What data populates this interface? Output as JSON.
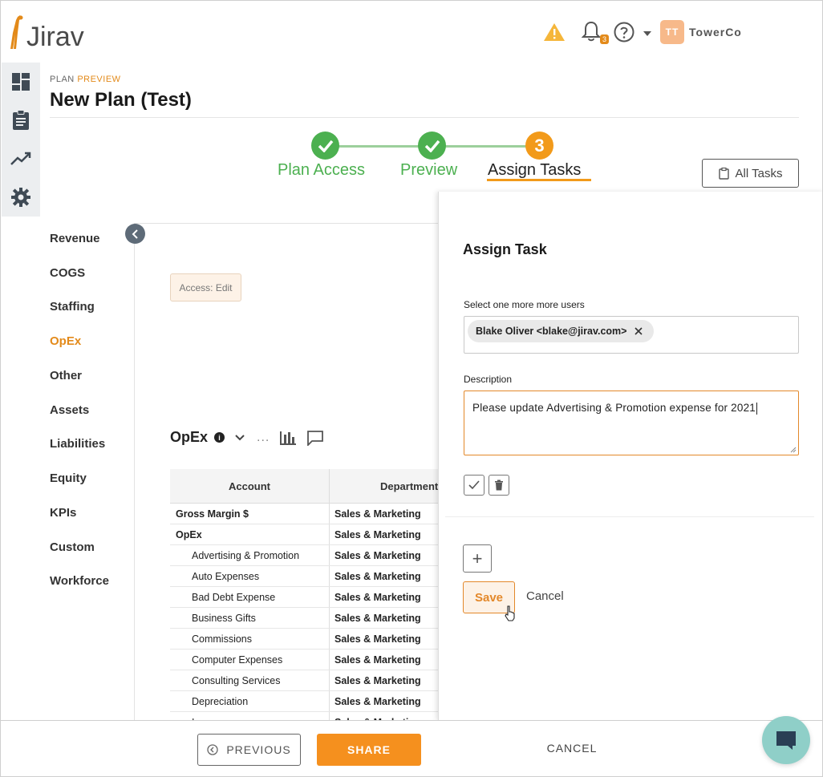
{
  "app": {
    "name": "Jirav"
  },
  "topbar": {
    "notification_count": "3",
    "avatar_initials": "TT",
    "company": "TowerCo"
  },
  "header": {
    "crumb_prefix": "PLAN",
    "crumb_highlight": "PREVIEW",
    "title": "New Plan (Test)"
  },
  "stepper": {
    "steps": [
      {
        "label": "Plan Access",
        "state": "done"
      },
      {
        "label": "Preview",
        "state": "done"
      },
      {
        "label": "Assign Tasks",
        "state": "current",
        "number": "3"
      }
    ]
  },
  "all_tasks_label": "All Tasks",
  "nav": {
    "items": [
      {
        "label": "Revenue"
      },
      {
        "label": "COGS"
      },
      {
        "label": "Staffing"
      },
      {
        "label": "OpEx",
        "active": true
      },
      {
        "label": "Other"
      },
      {
        "label": "Assets"
      },
      {
        "label": "Liabilities"
      },
      {
        "label": "Equity"
      },
      {
        "label": "KPIs"
      },
      {
        "label": "Custom"
      },
      {
        "label": "Workforce"
      }
    ]
  },
  "access_chip": "Access: Edit",
  "opex": {
    "title": "OpEx",
    "info_glyph": "i",
    "ellipsis": "..."
  },
  "table": {
    "columns": [
      "Account",
      "Department"
    ],
    "rows": [
      {
        "account": "Gross Margin $",
        "department": "Sales & Marketing",
        "bold": true,
        "indent": false
      },
      {
        "account": "OpEx",
        "department": "Sales & Marketing",
        "bold": true,
        "indent": false
      },
      {
        "account": "Advertising & Promotion",
        "department": "Sales & Marketing",
        "bold": false,
        "indent": true
      },
      {
        "account": "Auto Expenses",
        "department": "Sales & Marketing",
        "bold": false,
        "indent": true
      },
      {
        "account": "Bad Debt Expense",
        "department": "Sales & Marketing",
        "bold": false,
        "indent": true
      },
      {
        "account": "Business Gifts",
        "department": "Sales & Marketing",
        "bold": false,
        "indent": true
      },
      {
        "account": "Commissions",
        "department": "Sales & Marketing",
        "bold": false,
        "indent": true
      },
      {
        "account": "Computer Expenses",
        "department": "Sales & Marketing",
        "bold": false,
        "indent": true
      },
      {
        "account": "Consulting Services",
        "department": "Sales & Marketing",
        "bold": false,
        "indent": true
      },
      {
        "account": "Depreciation",
        "department": "Sales & Marketing",
        "bold": false,
        "indent": true
      },
      {
        "account": "Insurance",
        "department": "Sales & Marketing",
        "bold": false,
        "indent": true
      }
    ]
  },
  "panel": {
    "title": "Assign Task",
    "users_label": "Select one more more users",
    "selected_user": "Blake Oliver <blake@jirav.com>",
    "description_label": "Description",
    "description_value": "Please update Advertising & Promotion expense for 2021",
    "add_glyph": "+",
    "save_label": "Save",
    "cancel_label": "Cancel"
  },
  "footer": {
    "previous_label": "PREVIOUS",
    "share_label": "SHARE",
    "cancel_label": "CANCEL"
  },
  "colors": {
    "accent": "#f5901e",
    "success": "#4cb050",
    "rail": "#eceef0",
    "chat": "#8fcfc8"
  }
}
